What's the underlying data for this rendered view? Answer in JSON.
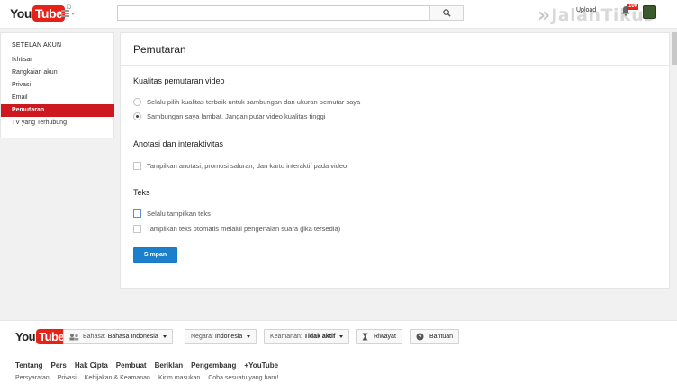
{
  "header": {
    "logo_you": "You",
    "logo_tube": "Tube",
    "logo_region": "ID",
    "search_placeholder": "",
    "upload_label": "Upload",
    "notification_count": "100",
    "watermark_text": "JalanTikus"
  },
  "sidebar": {
    "heading": "SETELAN AKUN",
    "items": [
      {
        "label": "Ikhtisar",
        "active": false
      },
      {
        "label": "Rangkaian akun",
        "active": false
      },
      {
        "label": "Privasi",
        "active": false
      },
      {
        "label": "Email",
        "active": false
      },
      {
        "label": "Pemutaran",
        "active": true
      },
      {
        "label": "TV yang Terhubung",
        "active": false
      }
    ]
  },
  "main": {
    "title": "Pemutaran",
    "sections": [
      {
        "title": "Kualitas pemutaran video",
        "options": [
          {
            "type": "radio",
            "label": "Selalu pilih kualitas terbaik untuk sambungan dan ukuran pemutar saya",
            "checked": false
          },
          {
            "type": "radio",
            "label": "Sambungan saya lambat. Jangan putar video kualitas tinggi",
            "checked": true
          }
        ]
      },
      {
        "title": "Anotasi dan interaktivitas",
        "options": [
          {
            "type": "checkbox",
            "label": "Tampilkan anotasi, promosi saluran, dan kartu interaktif pada video",
            "checked": false
          }
        ]
      },
      {
        "title": "Teks",
        "options": [
          {
            "type": "checkbox",
            "label": "Selalu tampilkan teks",
            "checked": false
          },
          {
            "type": "checkbox",
            "label": "Tampilkan teks otomatis melalui pengenalan suara (jika tersedia)",
            "checked": false
          }
        ]
      }
    ],
    "save_label": "Simpan"
  },
  "footer": {
    "logo_you": "You",
    "logo_tube": "Tube",
    "language_label": "Bahasa:",
    "language_value": "Bahasa Indonesia",
    "country_label": "Negara:",
    "country_value": "Indonesia",
    "safety_label": "Keamanan:",
    "safety_value": "Tidak aktif",
    "history_label": "Riwayat",
    "help_label": "Bantuan",
    "primary_links": [
      "Tentang",
      "Pers",
      "Hak Cipta",
      "Pembuat",
      "Beriklan",
      "Pengembang",
      "+YouTube"
    ],
    "secondary_links": [
      "Persyaratan",
      "Privasi",
      "Kebijakan & Keamanan",
      "Kirim masukan",
      "Coba sesuatu yang baru!"
    ]
  },
  "colors": {
    "brand_red": "#e62117",
    "active_nav": "#cc181e",
    "primary_button": "#1b7fcc"
  }
}
